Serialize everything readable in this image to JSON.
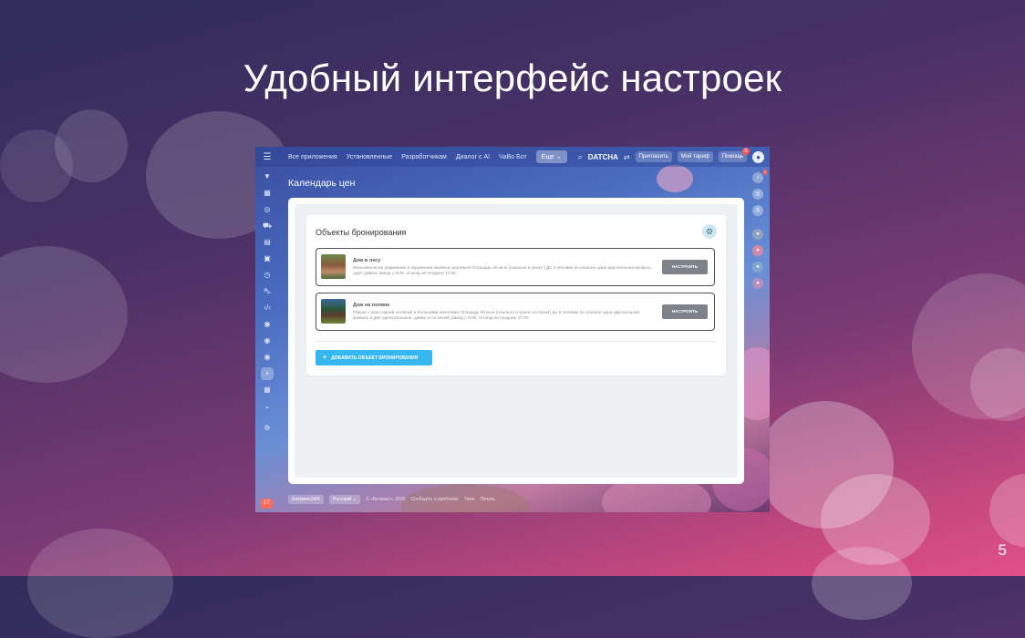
{
  "slide": {
    "title": "Удобный интерфейс настроек",
    "page_number": "5"
  },
  "topbar": {
    "nav": [
      "Все приложения",
      "Установленные",
      "Разработчикам",
      "Диалог с AI",
      "ЧаВо Бот"
    ],
    "more_label": "Еще ⌄",
    "brand": "DATCHA",
    "invite_label": "Пригласить",
    "tariff_label": "Мой тариф",
    "help_label": "Помощь",
    "help_badge": "5"
  },
  "rightbar": {
    "notifications_badge": "1"
  },
  "page": {
    "title": "Календарь цен"
  },
  "booking": {
    "card_title": "Объекты бронирования",
    "items": [
      {
        "name": "Дом в лесу",
        "description": "Максимальное уединение в окружении хвойных деревьев Площадь 40 кв.м (спальня и кухня ) До 4 человек (в спальне одна двуспальная кровать, один диван) Заезд с 9:00, отъезд не позднее 17:00",
        "button": "НАСТРОИТЬ"
      },
      {
        "name": "Дом на поляне",
        "description": "Рядом с просторной поляной и большими качелями Площадь 60 кв.м (спальня и кухня-гостиная) До 6 человек (в спальне одна двуспальная кровать и две односпальные, диван в гостиной) Заезд с 9:00, отъезд не позднее 17:00",
        "button": "НАСТРОИТЬ"
      }
    ],
    "add_button": "ДОБАВИТЬ ОБЪЕКТ БРОНИРОВАНИЯ"
  },
  "footer": {
    "brand": "Битрикс24®",
    "language": "Русский ⌄",
    "copyright": "© «Битрикс», 2025",
    "links": [
      "Сообщить о проблеме",
      "Тема",
      "Печать"
    ]
  },
  "left_badge": "17"
}
